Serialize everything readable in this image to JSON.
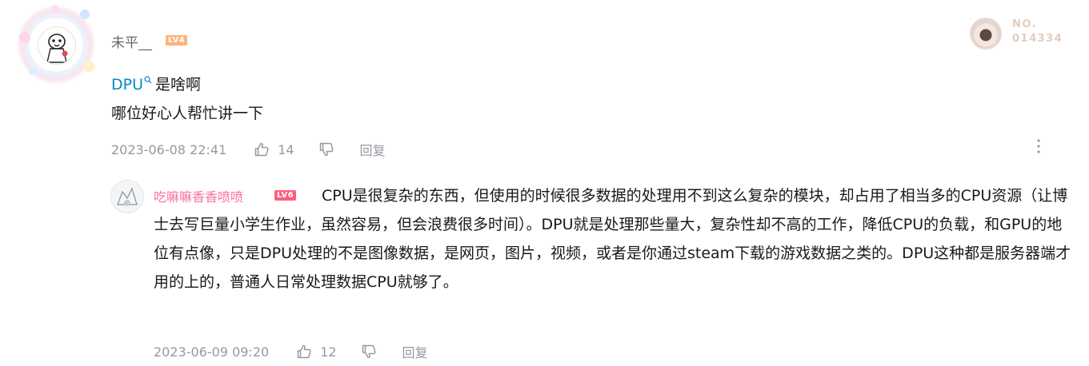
{
  "comment": {
    "username": "未平__",
    "level": "LV4",
    "nft": {
      "label": "NO.",
      "number": "014334"
    },
    "jump_word": "DPU",
    "line1_rest": "是啥啊",
    "line2": "哪位好心人帮忙讲一下",
    "time": "2023-06-08 22:41",
    "likes": "14",
    "reply_label": "回复"
  },
  "reply": {
    "username": "吃嘛嘛香香喷喷",
    "level": "LV6",
    "text": "CPU是很复杂的东西，但使用的时候很多数据的处理用不到这么复杂的模块，却占用了相当多的CPU资源（让博士去写巨量小学生作业，虽然容易，但会浪费很多时间）。DPU就是处理那些量大，复杂性却不高的工作，降低CPU的负载，和GPU的地位有点像，只是DPU处理的不是图像数据，是网页，图片，视频，或者是你通过steam下载的游戏数据之类的。DPU这种都是服务器端才用的上的，普通人日常处理数据CPU就够了。",
    "time": "2023-06-09 09:20",
    "likes": "12",
    "reply_label": "回复"
  },
  "icons": [
    "avatar-frame",
    "search-icon",
    "thumb-up-icon",
    "thumb-down-icon",
    "more-icon"
  ]
}
